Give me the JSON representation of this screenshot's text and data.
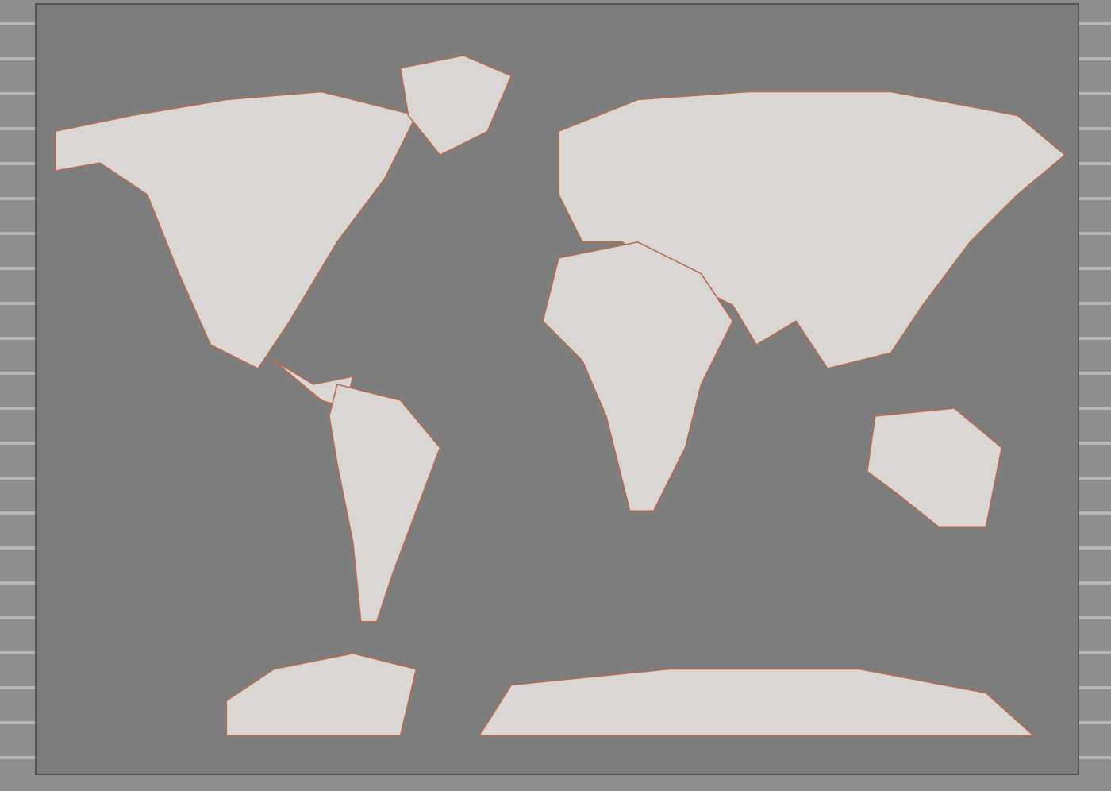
{
  "scene": {
    "kind": "map-poster"
  }
}
